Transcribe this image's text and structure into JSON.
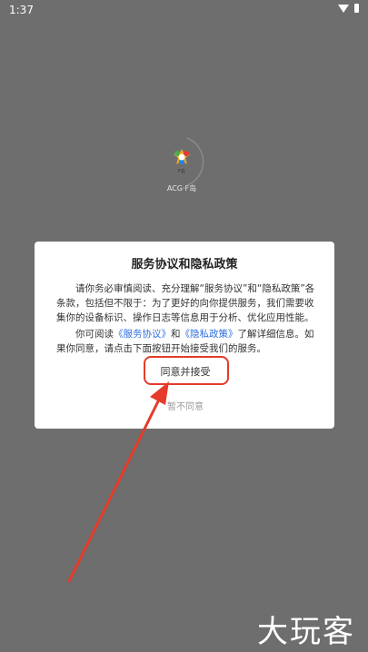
{
  "status_bar": {
    "time": "1:37",
    "wifi_icon": "wifi-icon",
    "battery_icon": "battery-icon"
  },
  "splash": {
    "app_name": "ACG·F岛",
    "logo_label": "F岛"
  },
  "dialog": {
    "title": "服务协议和隐私政策",
    "paragraph1": "请你务必审慎阅读、充分理解“服务协议”和“隐私政策”各条款，包括但不限于：为了更好的向你提供服务，我们需要收集你的设备标识、操作日志等信息用于分析、优化应用性能。",
    "paragraph2_prefix": "你可阅读",
    "service_link": "《服务协议》",
    "and_text": "和",
    "privacy_link": "《隐私政策》",
    "paragraph2_suffix": "了解详细信息。如果你同意，请点击下面按钮开始接受我们的服务。",
    "agree_label": "同意并接受",
    "disagree_label": "暂不同意"
  },
  "annotation": {
    "color": "#e53b2a"
  },
  "watermark": {
    "text": "大玩客"
  }
}
